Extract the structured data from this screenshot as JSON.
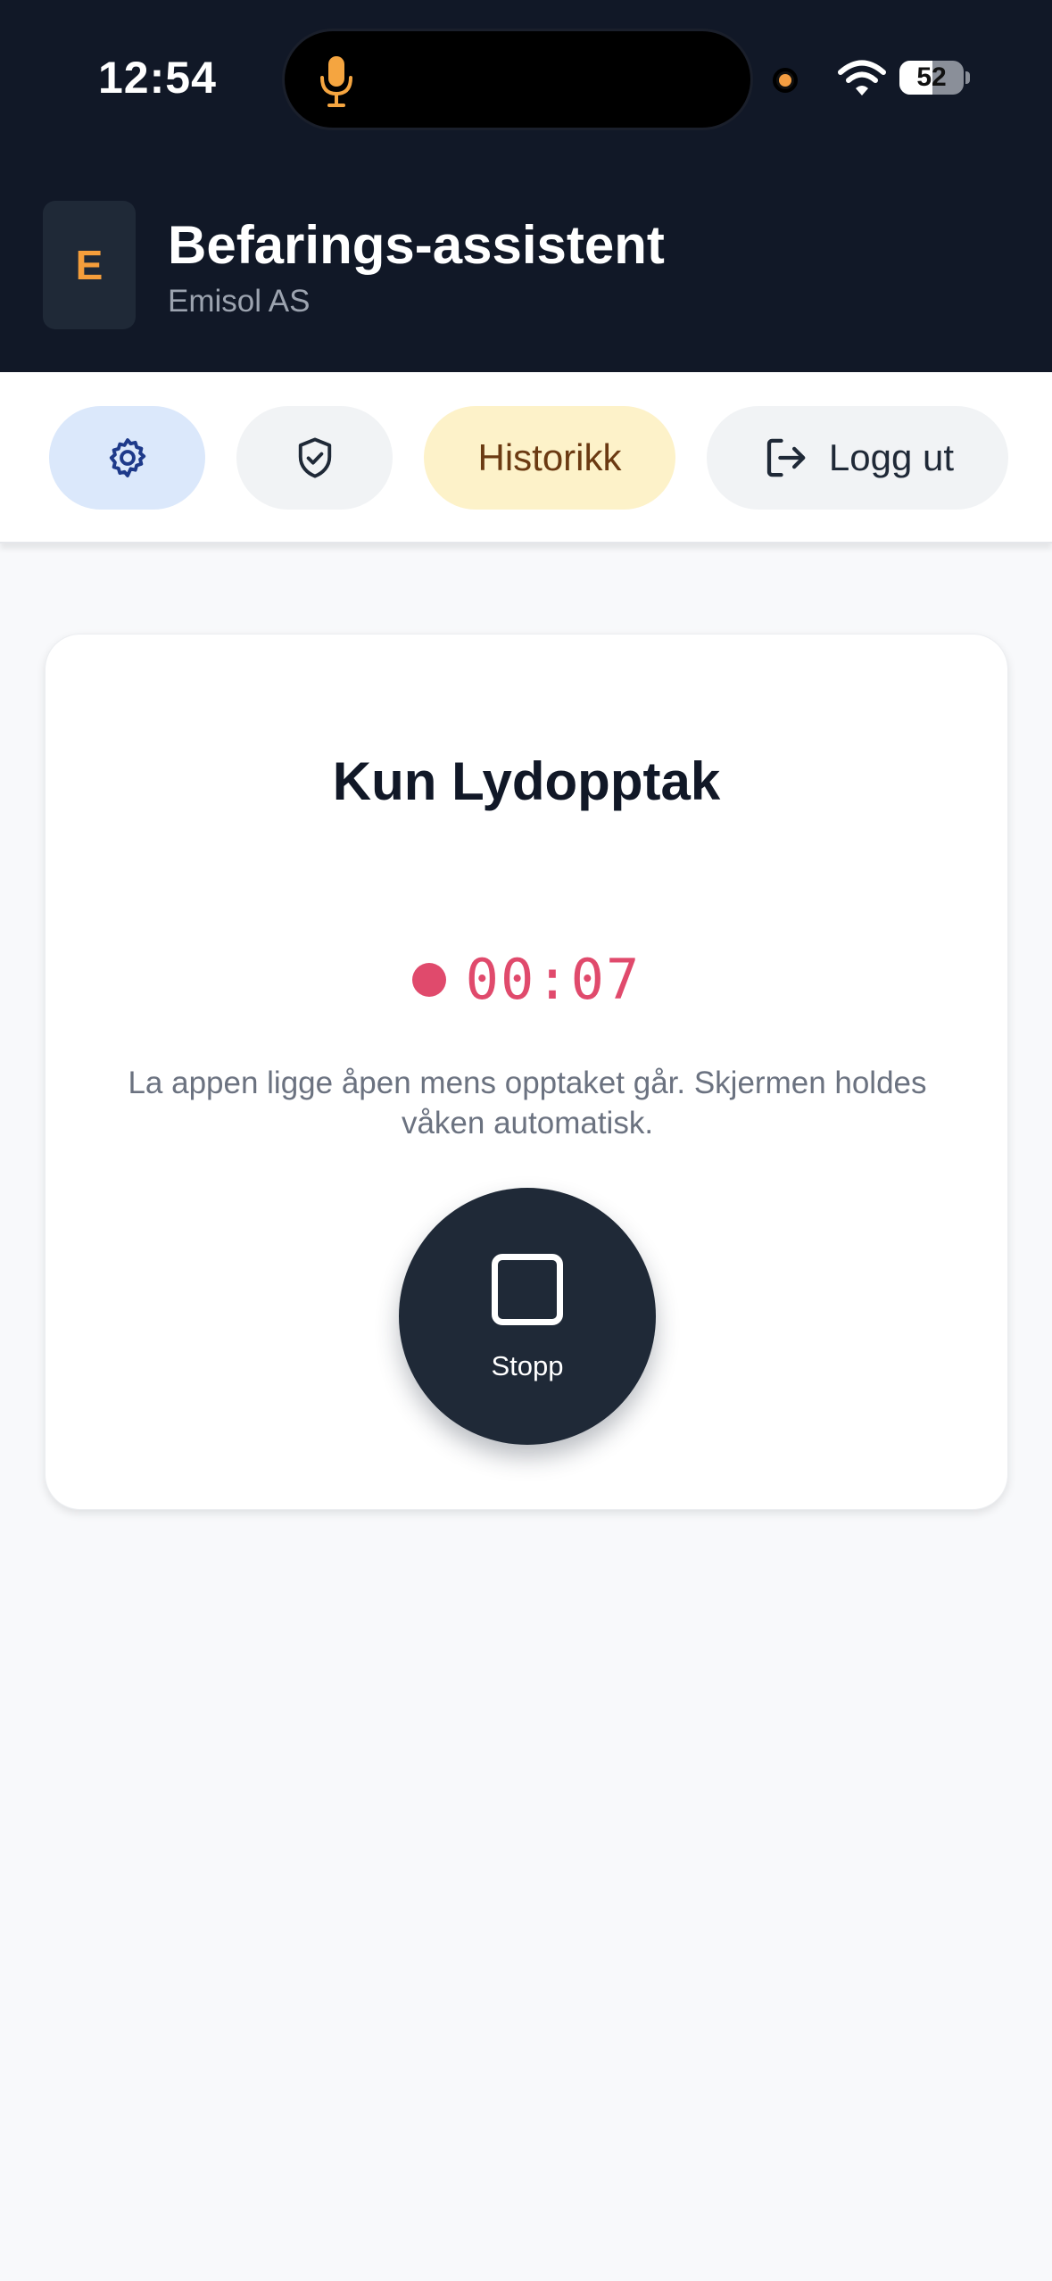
{
  "status_bar": {
    "time": "12:54",
    "battery_level": "52",
    "battery_fraction": 0.52,
    "icons": [
      "microphone-icon",
      "privacy-dot",
      "wifi-icon",
      "battery-icon"
    ]
  },
  "header": {
    "logo_letter": "E",
    "title": "Befarings-assistent",
    "subtitle": "Emisol AS"
  },
  "toolbar": {
    "settings_icon": "gear-icon",
    "security_icon": "shield-check-icon",
    "history_label": "Historikk",
    "logout_icon": "logout-icon",
    "logout_label": "Logg ut"
  },
  "recording": {
    "title": "Kun Lydopptak",
    "timer": "00:07",
    "hint": "La appen ligge åpen mens opptaket går. Skjermen holdes våken automatisk.",
    "stop_label": "Stopp"
  },
  "colors": {
    "header_bg": "#111827",
    "accent_orange": "#f59e3b",
    "recording_red": "#e04a6c",
    "stop_button_bg": "#1f2937",
    "settings_pill_bg": "#dbe8fb",
    "history_pill_bg": "#fdf2c9"
  }
}
